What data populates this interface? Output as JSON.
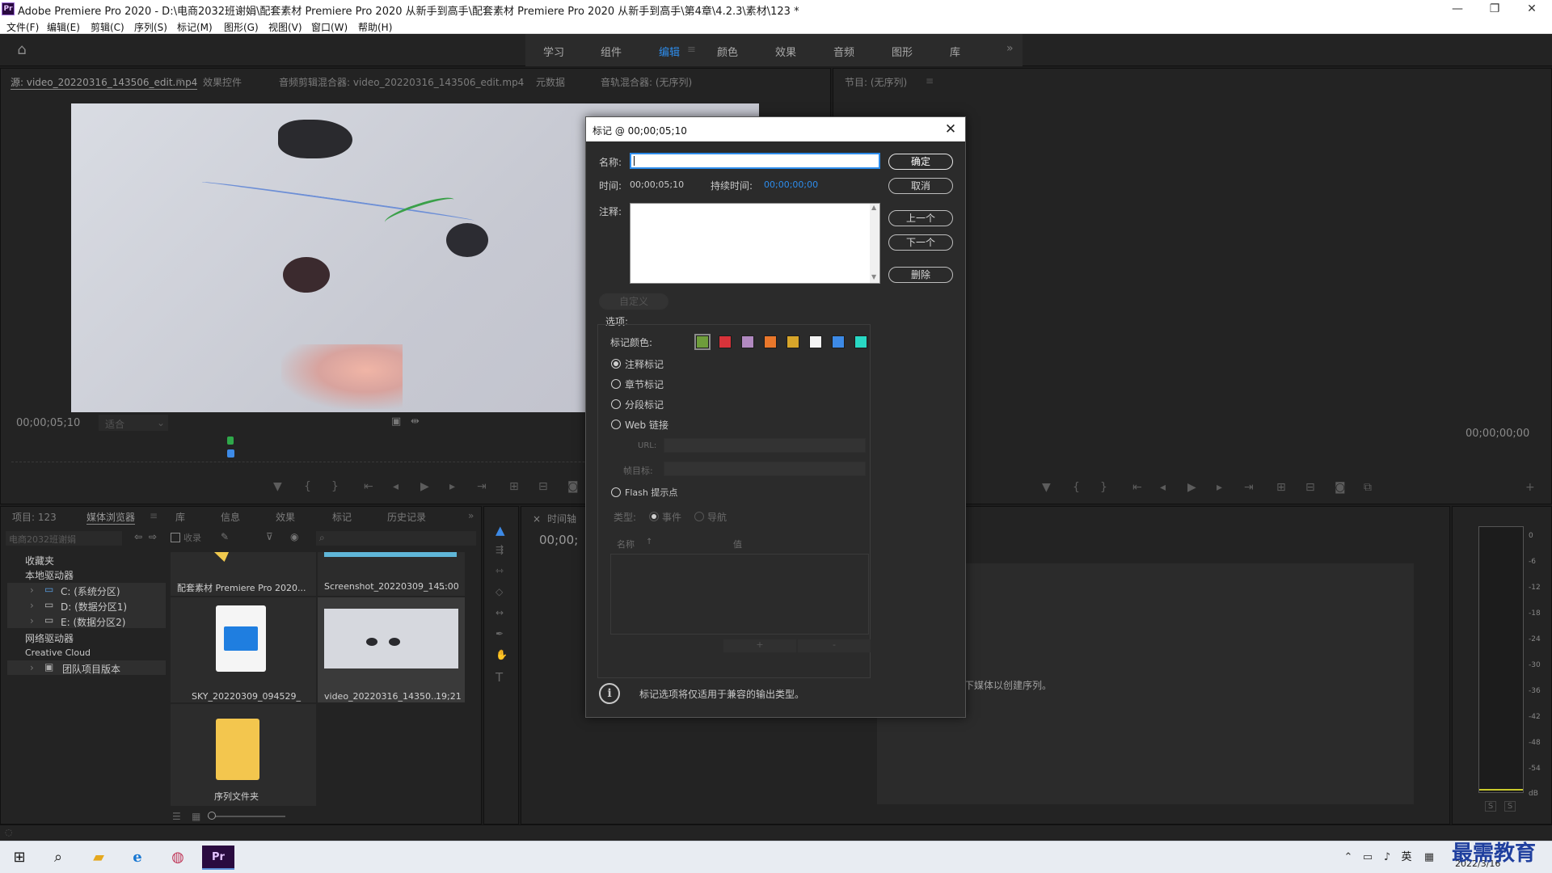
{
  "window": {
    "title": "Adobe Premiere Pro 2020 - D:\\电商2032班谢娟\\配套素材 Premiere Pro 2020 从新手到高手\\配套素材 Premiere Pro 2020 从新手到高手\\第4章\\4.2.3\\素材\\123 *",
    "app_icon": "Pr",
    "minimize": "—",
    "maximize": "❐",
    "close": "✕"
  },
  "menu": [
    "文件(F)",
    "编辑(E)",
    "剪辑(C)",
    "序列(S)",
    "标记(M)",
    "图形(G)",
    "视图(V)",
    "窗口(W)",
    "帮助(H)"
  ],
  "workspaces": {
    "tabs": [
      "学习",
      "组件",
      "编辑",
      "颜色",
      "效果",
      "音频",
      "图形",
      "库"
    ],
    "active": "编辑",
    "more": "»"
  },
  "source_panel": {
    "tabs": [
      "源: video_20220316_143506_edit.mp4",
      "效果控件",
      "音频剪辑混合器: video_20220316_143506_edit.mp4",
      "元数据",
      "音轨混合器: (无序列)"
    ],
    "timecode": "00;00;05;10",
    "fit": "适合"
  },
  "program_panel": {
    "title": "节目: (无序列)",
    "timecode": "00;00;00;00"
  },
  "project_panel": {
    "tabs": [
      "项目: 123",
      "媒体浏览器",
      "库",
      "信息",
      "效果",
      "标记",
      "历史记录"
    ],
    "location": "电商2032班谢娟",
    "ingest": "收录",
    "tree": [
      "收藏夹",
      "本地驱动器",
      "C: (系统分区)",
      "D: (数据分区1)",
      "E: (数据分区2)",
      "网络驱动器",
      "Creative Cloud",
      "团队项目版本"
    ],
    "tiles": [
      {
        "label": "配套素材 Premiere Pro 2020..."
      },
      {
        "label": "Screenshot_20220309_14...",
        "duration": "5:00"
      },
      {
        "label": "SKY_20220309_094529_"
      },
      {
        "label": "video_20220316_14350...",
        "duration": "19;21"
      },
      {
        "label": "序列文件夹"
      }
    ]
  },
  "timeline_panel": {
    "tab": "时间轴",
    "timecode": "00;00;",
    "hint": "下媒体以创建序列。"
  },
  "meter": {
    "ticks": [
      "0",
      "-6",
      "-12",
      "-18",
      "-24",
      "-30",
      "-36",
      "-42",
      "-48",
      "-54",
      "dB"
    ],
    "solo": [
      "S",
      "S"
    ]
  },
  "dialog": {
    "title": "标记 @ 00;00;05;10",
    "name_label": "名称:",
    "time_label": "时间:",
    "time_value": "00;00;05;10",
    "duration_label": "持续时间:",
    "duration_value": "00;00;00;00",
    "comment_label": "注释:",
    "ok": "确定",
    "cancel": "取消",
    "prev": "上一个",
    "next": "下一个",
    "delete": "删除",
    "custom": "自定义",
    "options_label": "选项:",
    "color_label": "标记颜色:",
    "colors": [
      "#6e9d3b",
      "#d8333a",
      "#b189c0",
      "#e9772b",
      "#d7a52a",
      "#f3f3f3",
      "#3d8ae6",
      "#29d8c4"
    ],
    "marker_types": [
      "注释标记",
      "章节标记",
      "分段标记",
      "Web 链接"
    ],
    "url_label": "URL:",
    "frame_target_label": "帧目标:",
    "flash": "Flash 提示点",
    "type_label": "类型:",
    "type_options": [
      "事件",
      "导航"
    ],
    "col_name": "名称",
    "col_value": "值",
    "add": "+",
    "remove": "-",
    "info": "标记选项将仅适用于兼容的输出类型。"
  },
  "taskbar": {
    "ime": "英",
    "date": "2022/3/16",
    "watermark": "最需教育"
  }
}
